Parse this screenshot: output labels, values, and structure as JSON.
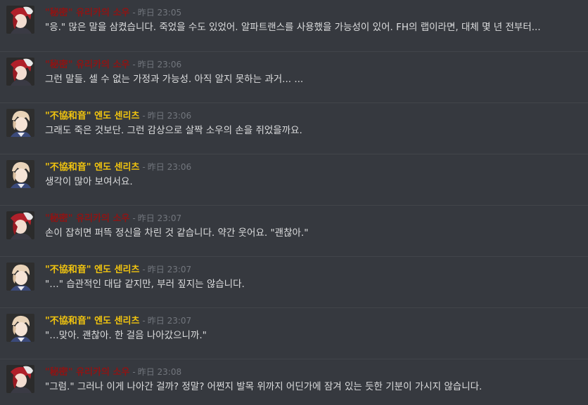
{
  "messages": [
    {
      "author_name": "\"秘密\" 유리카의 소우",
      "author_color": "#8e1414",
      "separator": "-",
      "timestamp": "昨日 23:05",
      "avatar": "sou-avatar",
      "content": "\"응.\" 많은 말을 삼켰습니다. 죽었을 수도 있었어. 알파트랜스를 사용했을 가능성이 있어. FH의 랩이라면, 대체 몇 년 전부터..."
    },
    {
      "author_name": "\"秘密\" 유리카의 소우",
      "author_color": "#8e1414",
      "separator": "-",
      "timestamp": "昨日 23:06",
      "avatar": "sou-avatar",
      "content": "그런 말들. 셀 수 없는 가정과 가능성. 아직 알지 못하는 과거... ..."
    },
    {
      "author_name": "\"不協和音\" 엔도 센리츠",
      "author_color": "#f1c40f",
      "separator": "-",
      "timestamp": "昨日 23:06",
      "avatar": "senritsu-avatar",
      "content": "그래도 죽은 것보단. 그런 감상으로 살짝 소우의 손을 쥐었을까요."
    },
    {
      "author_name": "\"不協和音\" 엔도 센리츠",
      "author_color": "#f1c40f",
      "separator": "-",
      "timestamp": "昨日 23:06",
      "avatar": "senritsu-avatar",
      "content": "생각이 많아 보여서요."
    },
    {
      "author_name": "\"秘密\" 유리카의 소우",
      "author_color": "#8e1414",
      "separator": "-",
      "timestamp": "昨日 23:07",
      "avatar": "sou-avatar",
      "content": "손이 잡히면 퍼뜩 정신을 차린 것 같습니다. 약간 웃어요. \"괜찮아.\""
    },
    {
      "author_name": "\"不協和音\" 엔도 센리츠",
      "author_color": "#f1c40f",
      "separator": "-",
      "timestamp": "昨日 23:07",
      "avatar": "senritsu-avatar",
      "content": "\"…\" 습관적인 대답 같지만, 부러 짚지는 않습니다."
    },
    {
      "author_name": "\"不協和音\" 엔도 센리츠",
      "author_color": "#f1c40f",
      "separator": "-",
      "timestamp": "昨日 23:07",
      "avatar": "senritsu-avatar",
      "content": "\"…맞아. 괜찮아. 한 걸음 나아갔으니까.\""
    },
    {
      "author_name": "\"秘密\" 유리카의 소우",
      "author_color": "#8e1414",
      "separator": "-",
      "timestamp": "昨日 23:08",
      "avatar": "sou-avatar",
      "content": "\"그럼.\" 그러나 이게 나아간 걸까? 정말? 어쩐지 발목 위까지 어딘가에 잠겨 있는 듯한 기분이 가시지 않습니다."
    }
  ]
}
